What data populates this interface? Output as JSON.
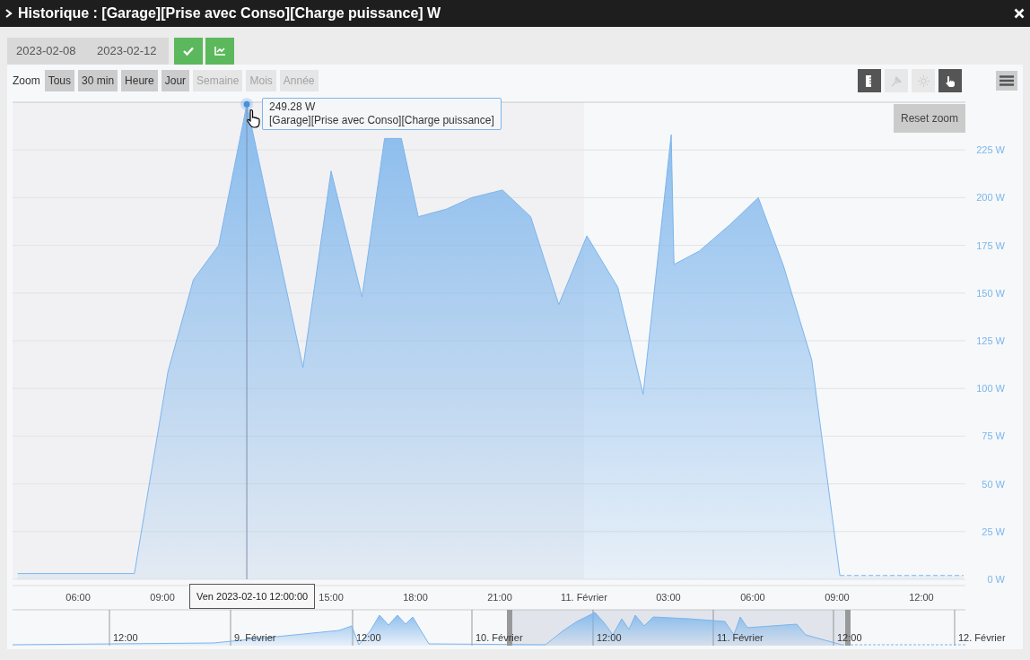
{
  "window": {
    "title": "Historique : [Garage][Prise avec Conso][Charge puissance] W"
  },
  "date_range": {
    "start": "2023-02-08",
    "end": "2023-02-12"
  },
  "zoom": {
    "label": "Zoom",
    "buttons": [
      {
        "label": "Tous",
        "disabled": false
      },
      {
        "label": "30 min",
        "disabled": false
      },
      {
        "label": "Heure",
        "disabled": false
      },
      {
        "label": "Jour",
        "disabled": false
      },
      {
        "label": "Semaine",
        "disabled": true
      },
      {
        "label": "Mois",
        "disabled": true
      },
      {
        "label": "Année",
        "disabled": true
      }
    ]
  },
  "tools": [
    {
      "kind": "ruler",
      "on": true
    },
    {
      "kind": "pin",
      "on": false
    },
    {
      "kind": "sun",
      "on": false
    },
    {
      "kind": "hand",
      "on": true
    }
  ],
  "reset_zoom": "Reset zoom",
  "tooltip": {
    "value": "249.28 W"
  },
  "crosshair_label": "Ven 2023-02-10 12:00:00",
  "chart_data": {
    "type": "area",
    "grid": true,
    "x": [
      "2023-02-10 03:51",
      "2023-02-10 08:00",
      "2023-02-10 09:12",
      "2023-02-10 10:06",
      "2023-02-10 11:00",
      "2023-02-10 12:00",
      "2023-02-10 14:00",
      "2023-02-10 15:00",
      "2023-02-10 16:06",
      "2023-02-10 16:54",
      "2023-02-10 17:30",
      "2023-02-10 18:06",
      "2023-02-10 19:06",
      "2023-02-10 20:00",
      "2023-02-10 21:06",
      "2023-02-10 22:06",
      "2023-02-10 23:06",
      "2023-02-11 00:06",
      "2023-02-11 01:12",
      "2023-02-11 02:06",
      "2023-02-11 03:06",
      "2023-02-11 03:12",
      "2023-02-11 04:06",
      "2023-02-11 05:12",
      "2023-02-11 06:12",
      "2023-02-11 07:06",
      "2023-02-11 08:06",
      "2023-02-11 09:06",
      "2023-02-11 13:30"
    ],
    "series": [
      {
        "name": "[Garage][Prise avec Conso][Charge puissance]",
        "color": "#7cb5ec",
        "values": [
          3,
          3,
          109,
          157,
          175,
          249,
          111,
          214,
          148,
          231,
          231,
          190,
          194,
          200,
          204,
          190,
          144,
          180,
          153,
          97,
          233,
          165,
          172,
          186,
          200,
          164,
          115,
          2,
          2
        ]
      }
    ],
    "bands": [
      {
        "axis": "x",
        "from": "2023-02-10 03:40",
        "to": "2023-02-11 00:00",
        "color": "#f1f1f4"
      }
    ],
    "ref_lines": [
      {
        "axis": "x",
        "value": "2023-02-10 12:00"
      }
    ],
    "xlim": [
      "2023-02-10 03:40",
      "2023-02-11 13:34"
    ],
    "ylim": [
      0,
      250
    ],
    "xticks": [
      {
        "value": "2023-02-10 06:00",
        "label": "06:00"
      },
      {
        "value": "2023-02-10 09:00",
        "label": "09:00"
      },
      {
        "value": "2023-02-10 15:00",
        "label": "15:00"
      },
      {
        "value": "2023-02-10 18:00",
        "label": "18:00"
      },
      {
        "value": "2023-02-10 21:00",
        "label": "21:00"
      },
      {
        "value": "2023-02-11 00:00",
        "label": "11. Février"
      },
      {
        "value": "2023-02-11 03:00",
        "label": "03:00"
      },
      {
        "value": "2023-02-11 06:00",
        "label": "06:00"
      },
      {
        "value": "2023-02-11 09:00",
        "label": "09:00"
      },
      {
        "value": "2023-02-11 12:00",
        "label": "12:00"
      }
    ],
    "yticks": [
      {
        "value": 0,
        "label": "0 W"
      },
      {
        "value": 25,
        "label": "25 W"
      },
      {
        "value": 50,
        "label": "50 W"
      },
      {
        "value": 75,
        "label": "75 W"
      },
      {
        "value": 100,
        "label": "100 W"
      },
      {
        "value": 125,
        "label": "125 W"
      },
      {
        "value": 150,
        "label": "150 W"
      },
      {
        "value": 175,
        "label": "175 W"
      },
      {
        "value": 200,
        "label": "200 W"
      },
      {
        "value": 225,
        "label": "225 W"
      }
    ]
  },
  "navigator": {
    "labels": [
      "12:00",
      "9. Février",
      "12:00",
      "10. Février",
      "12:00",
      "11. Février",
      "12:00",
      "12. Février"
    ]
  }
}
